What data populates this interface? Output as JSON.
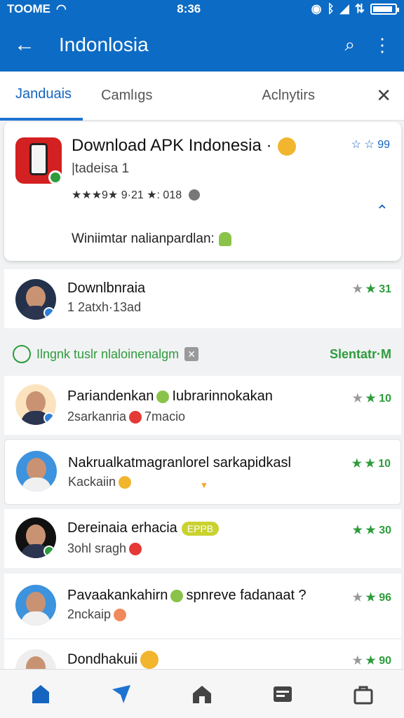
{
  "status_bar": {
    "carrier": "TOOME",
    "time": "8:36"
  },
  "app_bar": {
    "title": "Indonlosia"
  },
  "tabs": [
    {
      "label": "Janduais"
    },
    {
      "label": "Camlıgs"
    },
    {
      "label": "Aclnytirs"
    }
  ],
  "featured": {
    "title": "Download APK Indonesia ·",
    "subtitle": "|tadeisa 1",
    "rating": "★★★9★ 9·21 ★: 018",
    "fav": "☆ ☆ 99",
    "description": "Winiimtar nalianpardlan:"
  },
  "list": [
    {
      "name": "Downlbnraia",
      "meta": "1 2atxh·13ad",
      "score": "★ 31"
    },
    {
      "name": "Pariandenkan",
      "name2": "Iubrarinnokakan",
      "meta": "2sarkanria",
      "meta2": "7macio",
      "score": "★ 10"
    },
    {
      "name": "Nakrualkatmagranlorel sarkapidkasl",
      "meta": "Kackaiin",
      "score": "★ ★ 10"
    },
    {
      "name": "Dereinaia erhacia",
      "pill": "EPPB",
      "meta": "3ohl sragh",
      "score": "★ ★ 30"
    },
    {
      "name": "Pavaakankahirn",
      "name2": "spnreve fadanaat ?",
      "meta": "2nckaip",
      "score": "★ 96"
    },
    {
      "name": "Dondhakuii",
      "meta": "",
      "score": "★ 90"
    }
  ],
  "banner": {
    "left": "Ilngnk  tuslr nlaloinenalgm",
    "right": "Slentatr·M"
  },
  "colors": {
    "primary": "#0c6bc4",
    "accent_green": "#2e9c3c",
    "star": "#f4a623"
  }
}
